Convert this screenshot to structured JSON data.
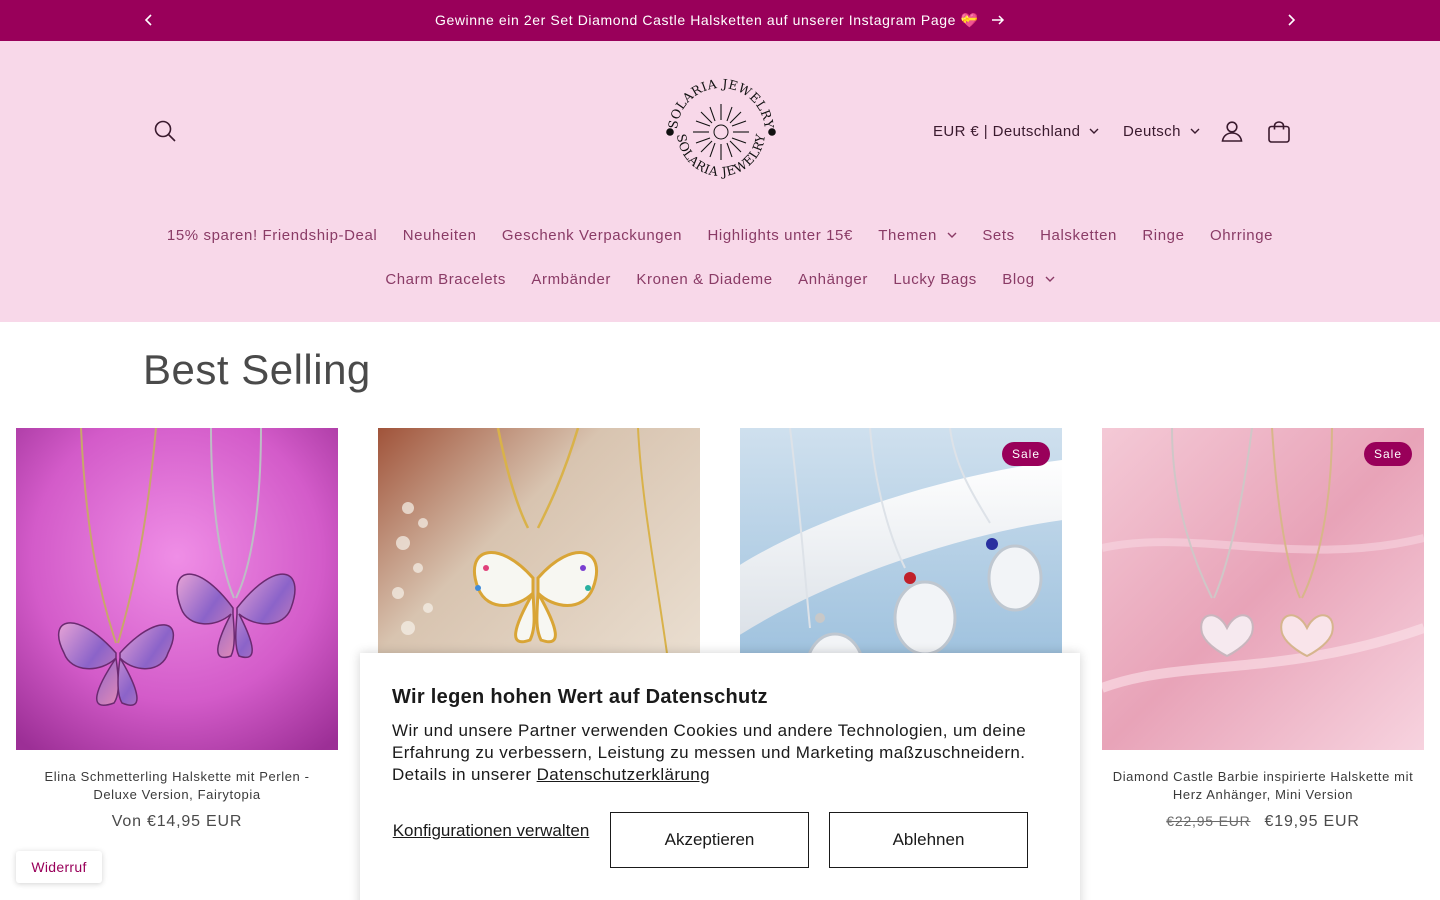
{
  "announcement": {
    "message": "Gewinne ein 2er Set Diamond Castle Halsketten auf unserer Instagram Page 💝",
    "bg_color": "#99005a"
  },
  "header": {
    "logo_text": "SOLARIA JEWELRY",
    "currency": "EUR € | Deutschland",
    "language": "Deutsch",
    "bg_color": "#f8d8e9"
  },
  "nav": {
    "row1": [
      {
        "label": "15% sparen! Friendship-Deal",
        "dropdown": false
      },
      {
        "label": "Neuheiten",
        "dropdown": false
      },
      {
        "label": "Geschenk Verpackungen",
        "dropdown": false
      },
      {
        "label": "Highlights unter 15€",
        "dropdown": false
      },
      {
        "label": "Themen",
        "dropdown": true
      },
      {
        "label": "Sets",
        "dropdown": false
      },
      {
        "label": "Halsketten",
        "dropdown": false
      },
      {
        "label": "Ringe",
        "dropdown": false
      },
      {
        "label": "Ohrringe",
        "dropdown": false
      }
    ],
    "row2": [
      {
        "label": "Charm Bracelets",
        "dropdown": false
      },
      {
        "label": "Armbänder",
        "dropdown": false
      },
      {
        "label": "Kronen & Diademe",
        "dropdown": false
      },
      {
        "label": "Anhänger",
        "dropdown": false
      },
      {
        "label": "Lucky Bags",
        "dropdown": false
      },
      {
        "label": "Blog",
        "dropdown": true
      }
    ]
  },
  "section": {
    "title": "Best Selling"
  },
  "products": [
    {
      "title": "Elina Schmetterling Halskette mit Perlen - Deluxe Version, Fairytopia",
      "price": "Von €14,95 EUR",
      "old_price": "",
      "badge": ""
    },
    {
      "title": "",
      "price": "",
      "old_price": "",
      "badge": ""
    },
    {
      "title": "",
      "price": "",
      "old_price": "",
      "badge": "Sale"
    },
    {
      "title": "Diamond Castle Barbie inspirierte Halskette mit Herz Anhänger, Mini Version",
      "price": "€19,95 EUR",
      "old_price": "€22,95 EUR",
      "badge": "Sale"
    }
  ],
  "cookie": {
    "title": "Wir legen hohen Wert auf Datenschutz",
    "text": "Wir und unsere Partner verwenden Cookies und andere Technologien, um deine Erfahrung zu verbessern, Leistung zu messen und Marketing maßzuschneidern. Details in unserer",
    "link": "Datenschutzerklärung",
    "config_label": "Konfigurationen verwalten",
    "accept_label": "Akzeptieren",
    "decline_label": "Ablehnen"
  },
  "widerruf": {
    "label": "Widerruf"
  },
  "icons": {
    "search": "search-icon",
    "account": "user-icon",
    "cart": "shopping-bag-icon",
    "prev": "chevron-left-icon",
    "next": "chevron-right-icon",
    "dropdown": "chevron-down-icon",
    "announce_arrow": "arrow-right-icon"
  }
}
